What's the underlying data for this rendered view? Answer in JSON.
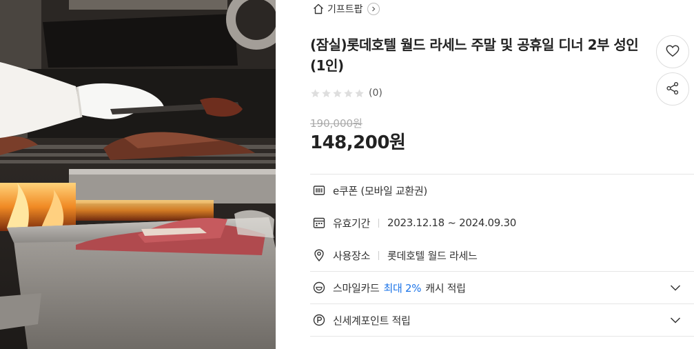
{
  "breadcrumb": {
    "label": "기프트팝"
  },
  "product": {
    "title": "(잠실)롯데호텔 월드 라세느 주말 및 공휴일 디너 2부 성인 (1인)",
    "rating_count": "(0)",
    "stars": 5,
    "filled_stars": 0,
    "original_price": "190,000원",
    "price": "148,200원"
  },
  "details": {
    "coupon_type": "e쿠폰 (모바일 교환권)",
    "validity_label": "유효기간",
    "validity_value": "2023.12.18 ~ 2024.09.30",
    "place_label": "사용장소",
    "place_value": "롯데호텔 월드 라세느"
  },
  "benefits": {
    "smile_prefix": "스마일카드",
    "smile_accent": "최대 2%",
    "smile_suffix": "캐시 적립",
    "shinsegae": "신세계포인트 적립"
  },
  "colors": {
    "accent": "#1a73e8",
    "divider": "#e5e5e5",
    "strike": "#aaaaaa"
  },
  "icons": {
    "home": "home-icon",
    "like": "heart-icon",
    "share": "share-icon",
    "coupon": "barcode-icon",
    "validity": "calendar-icon",
    "place": "location-pin-icon",
    "smile": "smile-card-icon",
    "point": "point-icon"
  }
}
